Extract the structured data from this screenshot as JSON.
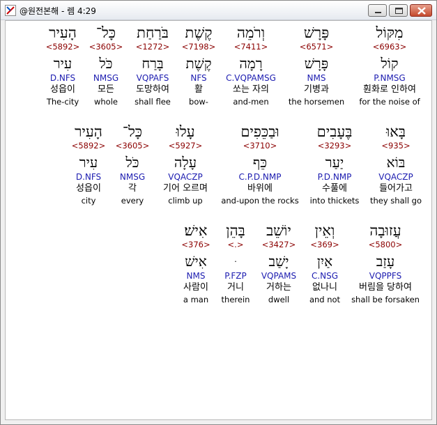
{
  "window": {
    "title": "@원전본해 - 렘 4:29",
    "app_icon": "app-logo-icon",
    "buttons": [
      "minimize-icon",
      "maximize-icon",
      "close-icon"
    ]
  },
  "colors": {
    "strong_number": "#8b0000",
    "grammar": "#1c1cb0",
    "text": "#000000",
    "background": "#ffffff"
  },
  "rows": [
    {
      "words": [
        {
          "hebrew": "מִקּוֹל",
          "strong": "<6963>",
          "lemma": "קוֹל",
          "grammar": "P.NMSG",
          "korean": "훤화로 인하여",
          "english": "for the noise of"
        },
        {
          "hebrew": "פָּרָשׁ",
          "strong": "<6571>",
          "lemma": "פָּרָשׁ",
          "grammar": "NMS",
          "korean": "기병과",
          "english": "the horsemen"
        },
        {
          "hebrew": "וְרֹמֵה",
          "strong": "<7411>",
          "lemma": "רָמָה",
          "grammar": "C.VQPAMSG",
          "korean": "쏘는 자의",
          "english": "and-men"
        },
        {
          "hebrew": "קֶשֶׁת",
          "strong": "<7198>",
          "lemma": "קֶשֶׁת",
          "grammar": "NFS",
          "korean": "활",
          "english": "bow-"
        },
        {
          "hebrew": "בֹּרַחַת",
          "strong": "<1272>",
          "lemma": "בָּרַח",
          "grammar": "VQPAFS",
          "korean": "도망하여",
          "english": "shall flee"
        },
        {
          "hebrew": "כָּל־",
          "strong": "<3605>",
          "lemma": "כֹּל",
          "grammar": "NMSG",
          "korean": "모든",
          "english": "whole"
        },
        {
          "hebrew": "הָעִיר",
          "strong": "<5892>",
          "lemma": "עִיר",
          "grammar": "D.NFS",
          "korean": "성읍이",
          "english": "The-city"
        }
      ]
    },
    {
      "words": [
        {
          "hebrew": "בָּאוּ",
          "strong": "<935>",
          "lemma": "בּוֹא",
          "grammar": "VQACZP",
          "korean": "들어가고",
          "english": "they shall go"
        },
        {
          "hebrew": "בֶּעָבִים",
          "strong": "<3293>",
          "lemma": "יַעַר",
          "grammar": "P.D.NMP",
          "korean": "수풀에",
          "english": "into thickets"
        },
        {
          "hebrew": "וּבַכֵּפִים",
          "strong": "<3710>",
          "lemma": "כֵּף",
          "grammar": "C.P.D.NMP",
          "korean": "바위에",
          "english": "and-upon the rocks"
        },
        {
          "hebrew": "עָלוּ",
          "strong": "<5927>",
          "lemma": "עָלָה",
          "grammar": "VQACZP",
          "korean": "기어 오르며",
          "english": "climb up"
        },
        {
          "hebrew": "כָּל־",
          "strong": "<3605>",
          "lemma": "כֹּל",
          "grammar": "NMSG",
          "korean": "각",
          "english": "every"
        },
        {
          "hebrew": "הָעִיר",
          "strong": "<5892>",
          "lemma": "עִיר",
          "grammar": "D.NFS",
          "korean": "성읍이",
          "english": "city"
        }
      ]
    },
    {
      "words": [
        {
          "hebrew": "עֲזוּבָה",
          "strong": "<5800>",
          "lemma": "עָזַב",
          "grammar": "VQPPFS",
          "korean": "버림을 당하여",
          "english": "shall be forsaken"
        },
        {
          "hebrew": "וְאֵין",
          "strong": "<369>",
          "lemma": "אַיִן",
          "grammar": "C.NSG",
          "korean": "없나니",
          "english": "and not"
        },
        {
          "hebrew": "יוֹשֵׁב",
          "strong": "<3427>",
          "lemma": "יָשַׁב",
          "grammar": "VQPAMS",
          "korean": "거하는",
          "english": "dwell"
        },
        {
          "hebrew": "בָּהֵן",
          "strong": "<.>",
          "lemma": "ּ",
          "grammar": "P.FZP",
          "korean": "거니",
          "english": "therein"
        },
        {
          "hebrew": "אִישׁ׃",
          "strong": "<376>",
          "lemma": "אִישׁ",
          "grammar": "NMS",
          "korean": "사람이",
          "english": "a man"
        }
      ]
    }
  ]
}
